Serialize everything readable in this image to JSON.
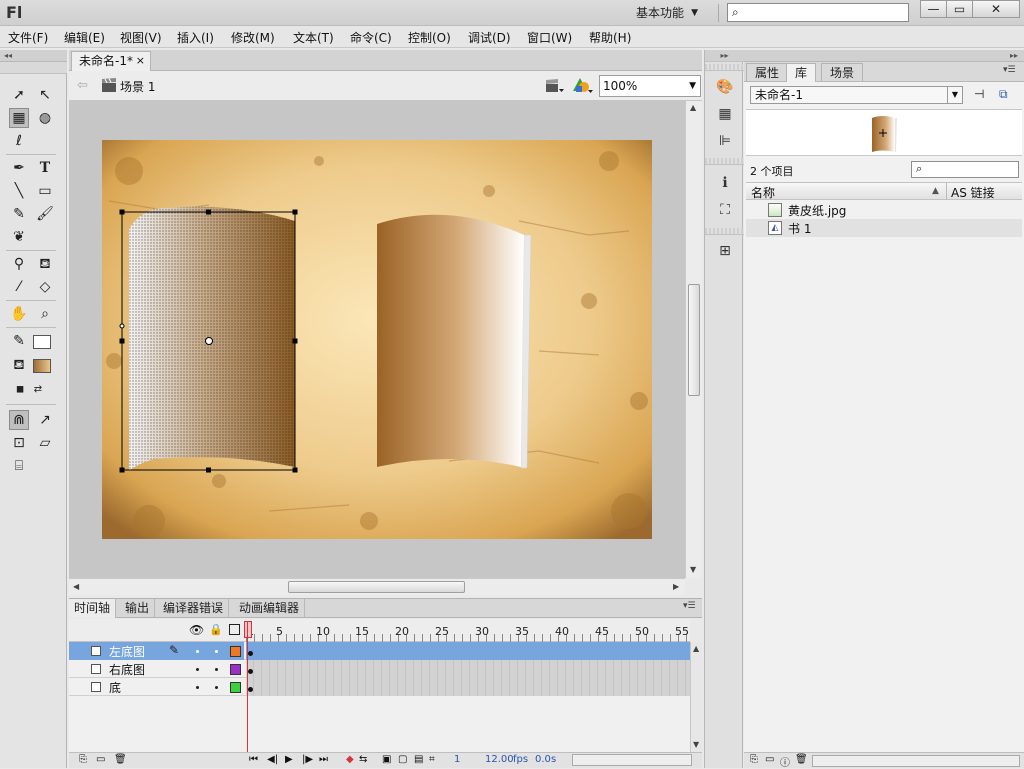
{
  "app": {
    "logo": "Fl",
    "workspace": "基本功能",
    "search_placeholder": ""
  },
  "window_buttons": {
    "minimize": "—",
    "maximize": "▭",
    "close": "✕"
  },
  "menu": [
    "文件(F)",
    "编辑(E)",
    "视图(V)",
    "插入(I)",
    "修改(M)",
    "文本(T)",
    "命令(C)",
    "控制(O)",
    "调试(D)",
    "窗口(W)",
    "帮助(H)"
  ],
  "document": {
    "tab_title": "未命名-1*",
    "tab_close": "×",
    "scene": "场景 1",
    "zoom": "100%"
  },
  "timeline": {
    "tabs": [
      "时间轴",
      "输出",
      "编译器错误",
      "动画编辑器"
    ],
    "frame_ticks": [
      "1",
      "5",
      "10",
      "15",
      "20",
      "25",
      "30",
      "35",
      "40",
      "45",
      "50",
      "55"
    ],
    "layers": [
      {
        "name": "左底图",
        "color": "#f07820",
        "selected": true
      },
      {
        "name": "右底图",
        "color": "#9b30c8",
        "selected": false
      },
      {
        "name": "底",
        "color": "#3cd23c",
        "selected": false
      }
    ],
    "status": {
      "frame": "1",
      "fps": "12.00",
      "fps_unit": "fps",
      "time": "0.0",
      "time_unit": "s"
    }
  },
  "library": {
    "tabs": [
      "属性",
      "库",
      "场景"
    ],
    "active_tab": "库",
    "document": "未命名-1",
    "item_count": "2 个项目",
    "columns": {
      "name": "名称",
      "linkage": "AS 链接"
    },
    "items": [
      {
        "name": "黄皮纸.jpg",
        "icon": "bitmap-icon"
      },
      {
        "name": "书 1",
        "icon": "graphic-symbol-icon"
      }
    ]
  },
  "colors": {
    "selection": "#77a5dd",
    "playhead": "#d9323a",
    "parchment": "#e9c88a"
  }
}
